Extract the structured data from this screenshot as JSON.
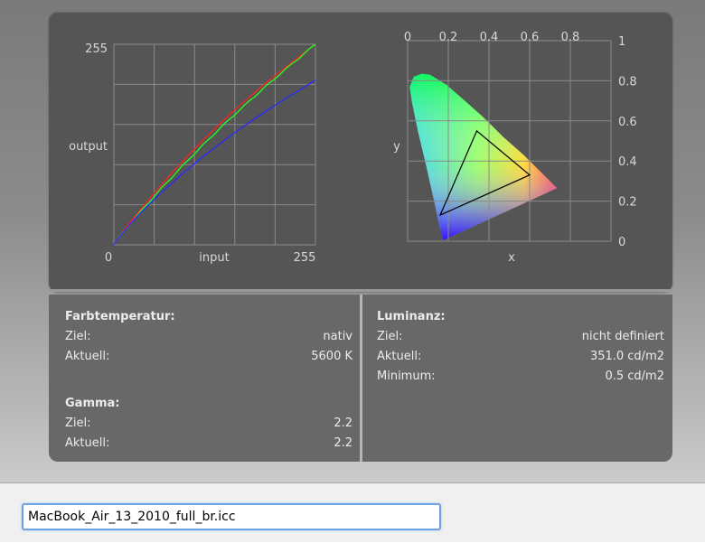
{
  "curve_chart": {
    "x_min_label": "0",
    "x_max_label": "255",
    "y_max_label": "255",
    "xlabel": "input",
    "ylabel": "output",
    "line_colors": [
      "#ff2020",
      "#20ff20",
      "#2a2aff"
    ]
  },
  "gamut_chart": {
    "x_ticks": [
      "0",
      "0.2",
      "0.4",
      "0.6",
      "0.8"
    ],
    "y_ticks": [
      "1",
      "0.8",
      "0.6",
      "0.4",
      "0.2",
      "0"
    ],
    "xlabel": "x",
    "ylabel": "y",
    "triangle": [
      [
        0.6,
        0.33
      ],
      [
        0.34,
        0.55
      ],
      [
        0.16,
        0.13
      ]
    ]
  },
  "info": {
    "color_temp": {
      "title": "Farbtemperatur:",
      "target_label": "Ziel:",
      "target_value": "nativ",
      "current_label": "Aktuell:",
      "current_value": "5600 K"
    },
    "gamma": {
      "title": "Gamma:",
      "target_label": "Ziel:",
      "target_value": "2.2",
      "current_label": "Aktuell:",
      "current_value": "2.2"
    },
    "luminance": {
      "title": "Luminanz:",
      "target_label": "Ziel:",
      "target_value": "nicht definiert",
      "current_label": "Aktuell:",
      "current_value": "351.0 cd/m2",
      "min_label": "Minimum:",
      "min_value": "0.5 cd/m2"
    }
  },
  "profile": {
    "filename": "MacBook_Air_13_2010_full_br.icc"
  }
}
